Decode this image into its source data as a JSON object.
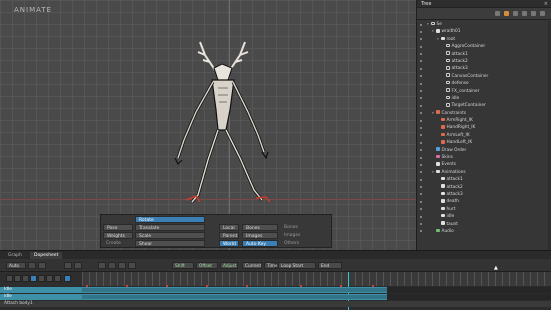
{
  "viewport": {
    "mode_label": "ANIMATE"
  },
  "toolbox": {
    "rotate": "Rotate",
    "translate": "Translate",
    "scale": "Scale",
    "shear": "Shear",
    "pose": "Pose",
    "weights": "Weights",
    "create": "Create",
    "local": "Local",
    "parent": "Parent",
    "world": "World",
    "bones": "Bones",
    "images": "Images",
    "auto_key": "Auto Key",
    "bones_label": "Bones",
    "images_label": "Images",
    "others_label": "Others"
  },
  "tree": {
    "title": "Tree",
    "rows": [
      {
        "label": "Se",
        "indent": 0,
        "icon": "slot",
        "arrow": "▾"
      },
      {
        "label": "wraith01",
        "indent": 1,
        "icon": "bone",
        "arrow": "▾"
      },
      {
        "label": "root",
        "indent": 2,
        "icon": "bone",
        "arrow": "▾"
      },
      {
        "label": "AggroContainer",
        "indent": 3,
        "icon": "slot",
        "arrow": ""
      },
      {
        "label": "attack1",
        "indent": 3,
        "icon": "slot",
        "arrow": ""
      },
      {
        "label": "attack2",
        "indent": 3,
        "icon": "slot",
        "arrow": ""
      },
      {
        "label": "attack3",
        "indent": 3,
        "icon": "slot",
        "arrow": ""
      },
      {
        "label": "CanvasContainer",
        "indent": 3,
        "icon": "slot",
        "arrow": ""
      },
      {
        "label": "defense",
        "indent": 3,
        "icon": "slot",
        "arrow": ""
      },
      {
        "label": "FX_container",
        "indent": 3,
        "icon": "slot",
        "arrow": ""
      },
      {
        "label": "idle",
        "indent": 3,
        "icon": "slot",
        "arrow": ""
      },
      {
        "label": "TargetContainer",
        "indent": 3,
        "icon": "slot",
        "arrow": ""
      },
      {
        "label": "Constraints",
        "indent": 1,
        "icon": "red",
        "arrow": "▾"
      },
      {
        "label": "ArmRight_IK",
        "indent": 2,
        "icon": "red",
        "arrow": ""
      },
      {
        "label": "HandRight_IK",
        "indent": 2,
        "icon": "red",
        "arrow": ""
      },
      {
        "label": "ArmLeft_IK",
        "indent": 2,
        "icon": "red",
        "arrow": ""
      },
      {
        "label": "HandLeft_IK",
        "indent": 2,
        "icon": "red",
        "arrow": ""
      },
      {
        "label": "Draw Order",
        "indent": 1,
        "icon": "blue",
        "arrow": ""
      },
      {
        "label": "Skins",
        "indent": 1,
        "icon": "pink",
        "arrow": ""
      },
      {
        "label": "Events",
        "indent": 1,
        "icon": "bone",
        "arrow": ""
      },
      {
        "label": "Animations",
        "indent": 1,
        "icon": "bone",
        "arrow": "▾"
      },
      {
        "label": "attack1",
        "indent": 2,
        "icon": "bone",
        "arrow": ""
      },
      {
        "label": "attack2",
        "indent": 2,
        "icon": "bone",
        "arrow": ""
      },
      {
        "label": "attack3",
        "indent": 2,
        "icon": "bone",
        "arrow": ""
      },
      {
        "label": "death",
        "indent": 2,
        "icon": "bone",
        "arrow": ""
      },
      {
        "label": "hurt",
        "indent": 2,
        "icon": "bone",
        "arrow": ""
      },
      {
        "label": "idle",
        "indent": 2,
        "icon": "bone",
        "arrow": ""
      },
      {
        "label": "taunt",
        "indent": 2,
        "icon": "bone",
        "arrow": ""
      },
      {
        "label": "Audio",
        "indent": 1,
        "icon": "green",
        "arrow": ""
      }
    ]
  },
  "bottom": {
    "tab_graph": "Graph",
    "tab_dopesheet": "Dopesheet",
    "controls": {
      "auto": "Auto",
      "shift": "Shift",
      "offset": "Offset",
      "adjust": "Adjust",
      "current": "Current",
      "time": "Time",
      "loop_start": "Loop Start",
      "end": "End"
    },
    "rows": [
      {
        "label": "Idle"
      },
      {
        "label": "idle"
      },
      {
        "label": "Attach body1"
      }
    ]
  }
}
